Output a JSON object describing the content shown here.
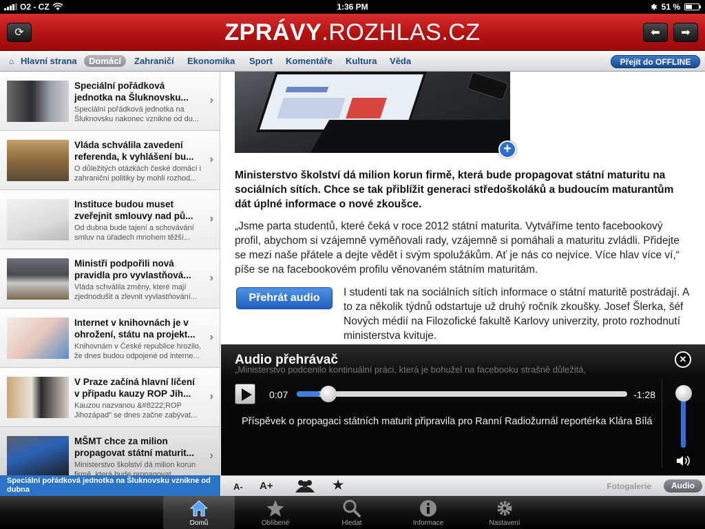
{
  "status_bar": {
    "carrier": "O2 - CZ",
    "time": "1:36 PM",
    "battery": "51 %",
    "battery_level": 0.51
  },
  "header": {
    "logo_bold": "ZPRÁVY",
    "logo_rest": ".ROZHLAS.CZ"
  },
  "nav": {
    "items": [
      "Hlavní strana",
      "Domácí",
      "Zahraničí",
      "Ekonomika",
      "Sport",
      "Komentáře",
      "Kultura",
      "Věda"
    ],
    "active": "Domácí",
    "offline_button": "Přejít do OFFLINE"
  },
  "articles": [
    {
      "title": "Speciální pořádková jednotka na Šluknovsku...",
      "desc": "Speciální pořádková jednotka na Šluknovsku nakonec vznikne od du..."
    },
    {
      "title": "Vláda schválila zavedení referenda, k vyhlášení bu...",
      "desc": "O důležitých otázkách české domácí i zahraniční politiky by mohli rozhod..."
    },
    {
      "title": "Instituce budou muset zveřejnit smlouvy nad pů...",
      "desc": "Od dubna bude tajení a schovávání smluv na úřadech mnohem těžší..."
    },
    {
      "title": "Ministři podpořili nová pravidla pro vyvlastňová...",
      "desc": "Vláda schválila změny, které mají zjednodušit a zlevnit vyvlastňování..."
    },
    {
      "title": "Internet v knihovnách je v ohrožení, státu na projekt...",
      "desc": "Knihovnám v České republice hrozilo, že dnes budou odpojené od interne..."
    },
    {
      "title": "V Praze začíná hlavní líčení v případu kauzy ROP Jih...",
      "desc": "Kauzou nazvanou &#8222;ROP Jihozápad\" se dnes začne zabývat..."
    },
    {
      "title": "MŠMT chce za milion propagovat státní maturit...",
      "desc": "Ministerstvo školství dá milion korun firmě, která bude propagovat..."
    }
  ],
  "ticker": "Speciální pořádková jednotka na Šluknovsku vznikne od dubna",
  "article": {
    "lead": "Ministerstvo školství dá milion korun firmě, která bude propagovat státní maturitu na sociálních sítích. Chce se tak přiblížit generaci středoškoláků a budoucím maturantům dát úplné informace o nové zkoušce.",
    "para1": "„Jsme parta studentů, které čeká v roce 2012 státní maturita. Vytváříme tento facebookový profil, abychom si vzájemně vyměňovali rady, vzájemně si pomáhali a maturitu zvládli. Přidejte se mezi naše přátele a dejte vědět i svým spolužákům. Ať je nás co nejvíce. Více hlav více ví,“ píše se na facebookovém profilu věnovaném státním maturitám.",
    "audio_button": "Přehrát audio",
    "para2": "I studenti tak na sociálních sítích informace o státní maturitě postrádají. A to za několik týdnů odstartuje už druhý ročník zkoušky. Josef Šlerka, šéf Nových médií na Filozofické fakultě Karlovy univerzity, proto rozhodnutí ministerstva kvituje."
  },
  "player": {
    "title": "Audio přehrávač",
    "ghost_text": "„Ministerstvo podcenilo kontinuální práci, která je bohužel na facebooku strašně důležitá,",
    "current": "0:07",
    "remaining": "-1:28",
    "progress": 0.07,
    "volume": 1.0,
    "caption": "Příspěvek o propagaci státních maturit připravila pro Ranní Radiožurnál reportérka Klára Bílá"
  },
  "toolbar": {
    "font_smaller": "A-",
    "font_larger": "A+",
    "gallery": "Fotogalerie",
    "audio": "Audio"
  },
  "tabs": [
    {
      "label": "Domů",
      "icon": "home-icon",
      "active": true
    },
    {
      "label": "Oblíbené",
      "icon": "star-icon",
      "active": false
    },
    {
      "label": "Hledat",
      "icon": "search-icon",
      "active": false
    },
    {
      "label": "Informace",
      "icon": "info-icon",
      "active": false
    },
    {
      "label": "Nastavení",
      "icon": "gear-icon",
      "active": false
    }
  ],
  "colors": {
    "header_red": "#c41b1b",
    "link_blue": "#1d4b8a",
    "accent_blue": "#2a73c8"
  }
}
